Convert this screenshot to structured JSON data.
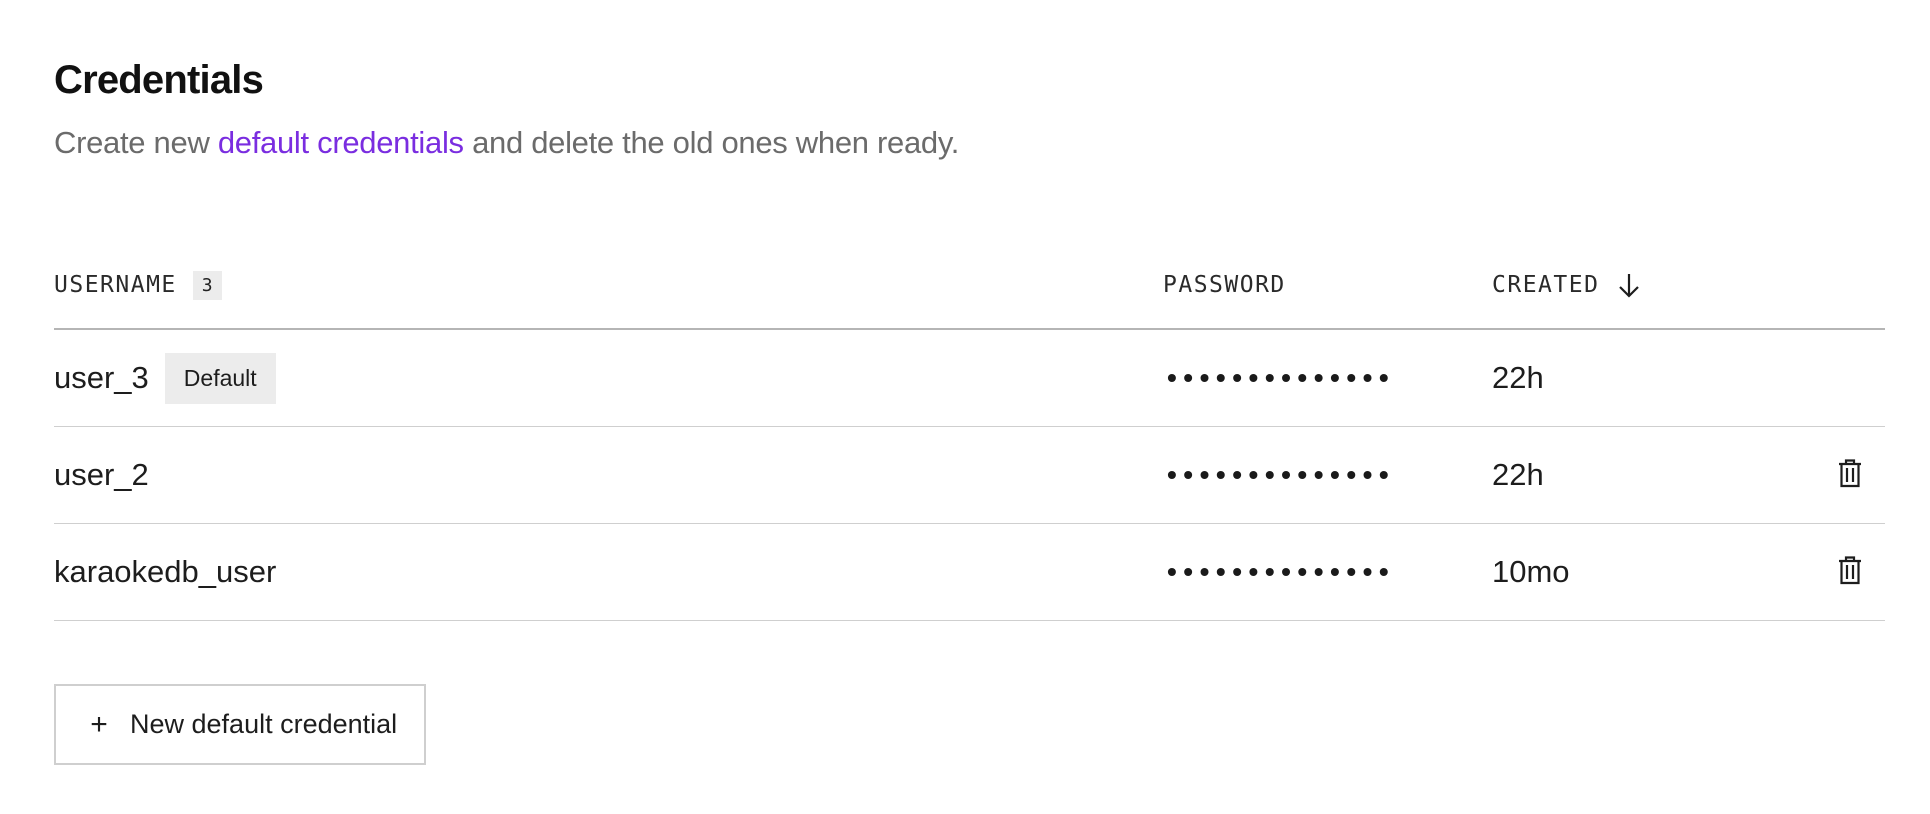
{
  "header": {
    "title": "Credentials",
    "subtitle_before": "Create new ",
    "subtitle_link": "default credentials",
    "subtitle_after": " and delete the old ones when ready."
  },
  "table": {
    "columns": {
      "username": "USERNAME",
      "username_count": "3",
      "password": "PASSWORD",
      "created": "CREATED"
    },
    "rows": [
      {
        "username": "user_3",
        "badge": "Default",
        "password": "••••••••••••••",
        "created": "22h",
        "deletable": false
      },
      {
        "username": "user_2",
        "badge": "",
        "password": "••••••••••••••",
        "created": "22h",
        "deletable": true
      },
      {
        "username": "karaokedb_user",
        "badge": "",
        "password": "••••••••••••••",
        "created": "10mo",
        "deletable": true
      }
    ]
  },
  "actions": {
    "new_credential_icon": "+",
    "new_credential_label": "New default credential"
  },
  "icons": {
    "sort": "arrow-down-icon",
    "delete": "trash-icon"
  },
  "colors": {
    "link": "#7a2de0",
    "badge_bg": "#ececec",
    "text": "#1a1a1a",
    "muted": "#6b6b6b"
  }
}
